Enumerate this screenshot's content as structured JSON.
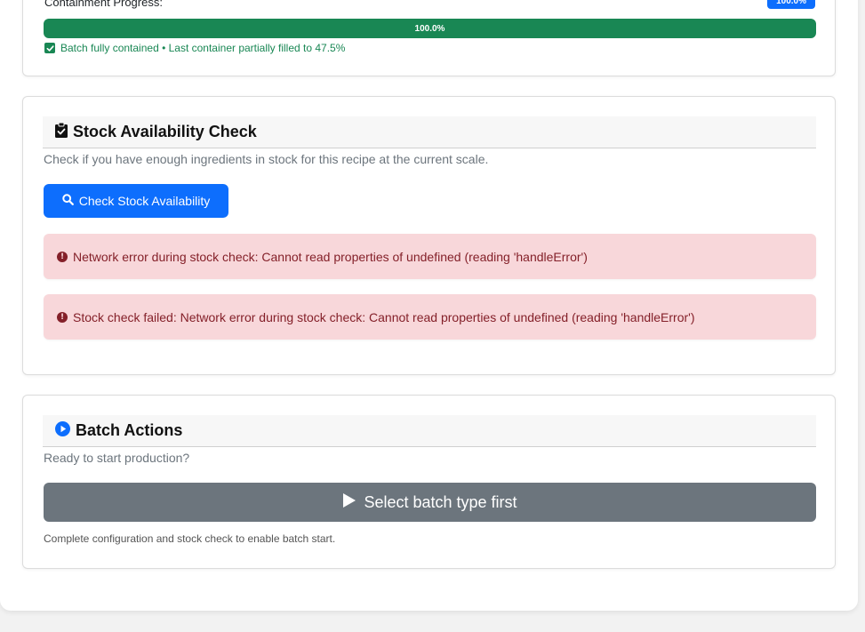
{
  "containment": {
    "label": "Containment Progress:",
    "badge": "100.0%",
    "progress_percent": 100.0,
    "progress_text": "100.0%",
    "status": "Batch fully contained • Last container partially filled to 47.5%",
    "status_color": "#198754"
  },
  "stock": {
    "title": "Stock Availability Check",
    "description": "Check if you have enough ingredients in stock for this recipe at the current scale.",
    "button_label": "Check Stock Availability",
    "errors": [
      "Network error during stock check: Cannot read properties of undefined (reading 'handleError')",
      "Stock check failed: Network error during stock check: Cannot read properties of undefined (reading 'handleError')"
    ]
  },
  "batch": {
    "title": "Batch Actions",
    "description": "Ready to start production?",
    "button_label": "Select batch type first",
    "note": "Complete configuration and stock check to enable batch start."
  },
  "colors": {
    "primary": "#0d6efd",
    "success": "#198754",
    "danger_bg": "#f8d7da",
    "danger_text": "#842029",
    "disabled": "#6c757d"
  },
  "icons": {
    "status": "check-square-icon",
    "stock_header": "clipboard-check-icon",
    "search": "search-icon",
    "error": "exclamation-circle-icon",
    "batch_header": "play-circle-icon",
    "start": "play-icon"
  }
}
